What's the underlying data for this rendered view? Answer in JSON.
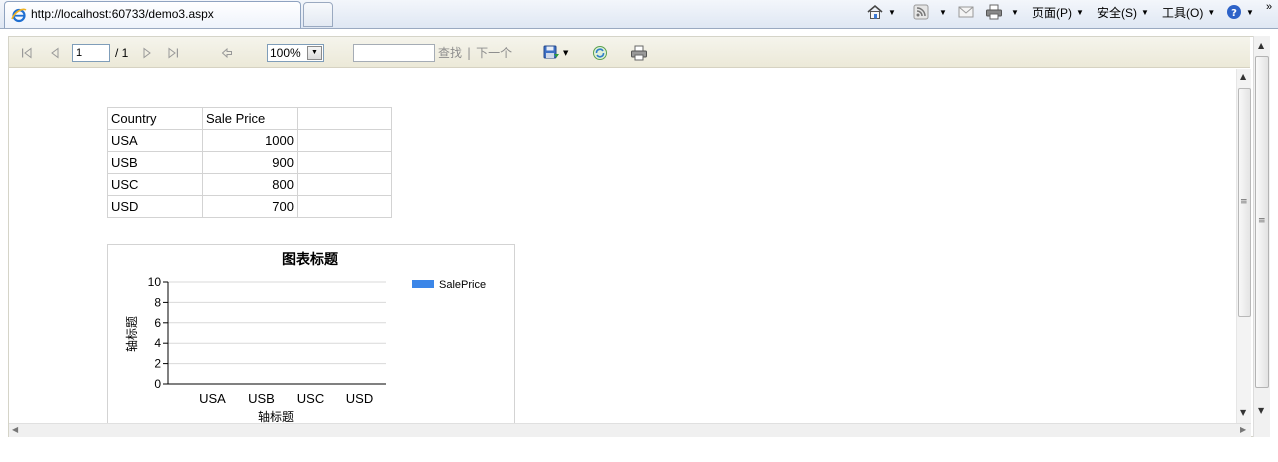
{
  "browser": {
    "tab_title": "http://localhost:60733/demo3.aspx",
    "overflow_chevron": "»",
    "commands": {
      "page_label": "页面(P)",
      "safety_label": "安全(S)",
      "tools_label": "工具(O)"
    }
  },
  "toolbar": {
    "page_value": "1",
    "page_total": "/ 1",
    "zoom_value": "100%",
    "find_label": "查找",
    "find_separator": "|",
    "find_next_label": "下一个"
  },
  "table": {
    "headers": [
      "Country",
      "Sale Price",
      ""
    ],
    "rows": [
      {
        "country": "USA",
        "price": "1000"
      },
      {
        "country": "USB",
        "price": "900"
      },
      {
        "country": "USC",
        "price": "800"
      },
      {
        "country": "USD",
        "price": "700"
      }
    ]
  },
  "chart_data": {
    "type": "bar",
    "title": "图表标题",
    "xlabel": "轴标题",
    "ylabel": "轴标题",
    "categories": [
      "USA",
      "USB",
      "USC",
      "USD"
    ],
    "series": [
      {
        "name": "SalePrice",
        "values": [
          0,
          0,
          0,
          0
        ],
        "color": "#3b86e8"
      }
    ],
    "ylim": [
      0,
      10
    ],
    "yticks": [
      0,
      2,
      4,
      6,
      8,
      10
    ],
    "grid": true,
    "legend": "top-right"
  },
  "colors": {
    "series": "#3b86e8",
    "toolbar_bg": "#ece9d8",
    "tab_border": "#8fa3c0"
  }
}
